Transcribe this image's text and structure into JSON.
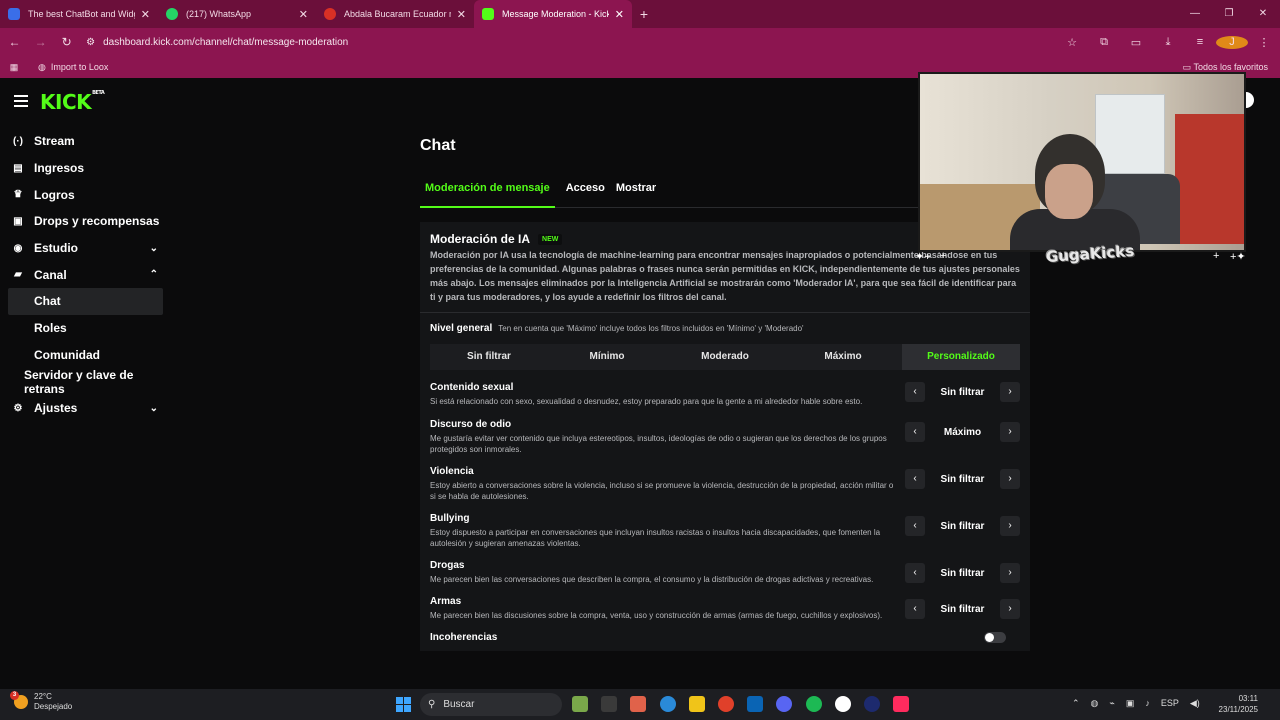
{
  "browser": {
    "tabs": [
      {
        "title": "The best ChatBot and Widgets",
        "color": "#3a6ee8"
      },
      {
        "title": "(217) WhatsApp",
        "color": "#25d366"
      },
      {
        "title": "Abdala Bucaram Ecuador me q",
        "color": "#d93025"
      },
      {
        "title": "Message Moderation - Kick Da",
        "color": "#53fc18"
      }
    ],
    "url": "dashboard.kick.com/channel/chat/message-moderation",
    "bookmarks": {
      "item": "Import to Loox",
      "right": "Todos los favoritos"
    },
    "profile_initial": "J"
  },
  "sidebar": {
    "items": [
      {
        "label": "Stream",
        "icon": "(·)"
      },
      {
        "label": "Ingresos",
        "icon": "▤"
      },
      {
        "label": "Logros",
        "icon": "🏆"
      },
      {
        "label": "Drops y recompensas",
        "icon": "🎁"
      },
      {
        "label": "Estudio",
        "icon": "⚙"
      },
      {
        "label": "Canal",
        "icon": "💬"
      },
      {
        "label": "Chat"
      },
      {
        "label": "Roles"
      },
      {
        "label": "Comunidad"
      },
      {
        "label": "Servidor y clave de retrans"
      },
      {
        "label": "Ajustes",
        "icon": "⚙"
      }
    ]
  },
  "main": {
    "title": "Chat",
    "tabs": [
      "Moderación de mensaje",
      "Acceso",
      "Mostrar"
    ],
    "ai": {
      "title": "Moderación de IA",
      "badge": "NEW",
      "description": "Moderación por IA usa la tecnología de machine-learning para encontrar mensajes inapropiados o potencialmente basándose en tus preferencias de la comunidad. Algunas palabras o frases nunca serán permitidas en KICK, independientemente de tus ajustes personales más abajo. Los mensajes eliminados por la Inteligencia Artificial se mostrarán como 'Moderador IA', para que sea fácil de identificar para ti y para tus moderadores, y los ayude a redefinir los filtros del canal."
    },
    "nivel": {
      "label": "Nivel general",
      "hint": "Ten en cuenta que 'Máximo' incluye todos los filtros incluidos en 'Mínimo' y 'Moderado'",
      "options": [
        "Sin filtrar",
        "Mínimo",
        "Moderado",
        "Máximo",
        "Personalizado"
      ],
      "selected": "Personalizado"
    },
    "criteria": [
      {
        "title": "Contenido sexual",
        "desc": "Si está relacionado con sexo, sexualidad o desnudez, estoy preparado para que la gente a mi alrededor hable sobre esto.",
        "value": "Sin filtrar"
      },
      {
        "title": "Discurso de odio",
        "desc": "Me gustaría evitar ver contenido que incluya estereotipos, insultos, ideologías de odio o sugieran que los derechos de los grupos protegidos son inmorales.",
        "value": "Máximo"
      },
      {
        "title": "Violencia",
        "desc": "Estoy abierto a conversaciones sobre la violencia, incluso si se promueve la violencia, destrucción de la propiedad, acción militar o si se habla de autolesiones.",
        "value": "Sin filtrar"
      },
      {
        "title": "Bullying",
        "desc": "Estoy dispuesto a participar en conversaciones que incluyan insultos racistas o insultos hacia discapacidades, que fomenten la autolesión y sugieran amenazas violentas.",
        "value": "Sin filtrar"
      },
      {
        "title": "Drogas",
        "desc": "Me parecen bien las conversaciones que describen la compra, el consumo y la distribución de drogas adictivas y recreativas.",
        "value": "Sin filtrar"
      },
      {
        "title": "Armas",
        "desc": "Me parecen bien las discusiones sobre la compra, venta, uso y construcción de armas (armas de fuego, cuchillos y explosivos).",
        "value": "Sin filtrar"
      }
    ],
    "incoherencias": {
      "title": "Incoherencias",
      "enabled": false
    }
  },
  "overlay": {
    "stream_text": "GugaKicks"
  },
  "taskbar": {
    "weather_temp": "22°C",
    "weather_desc": "Despejado",
    "weather_badge": "3",
    "search": "Buscar",
    "lang": "ESP",
    "time": "03:11",
    "date": "23/11/2025",
    "app_colors": [
      "#7aa84a",
      "#3a3a3a",
      "#e0624a",
      "#2a8ad8",
      "#f0c419",
      "#e0402a",
      "#0a64b4",
      "#5865f2",
      "#1db954",
      "#ffffff",
      "#1d2a6e",
      "#ff2b5e"
    ]
  }
}
